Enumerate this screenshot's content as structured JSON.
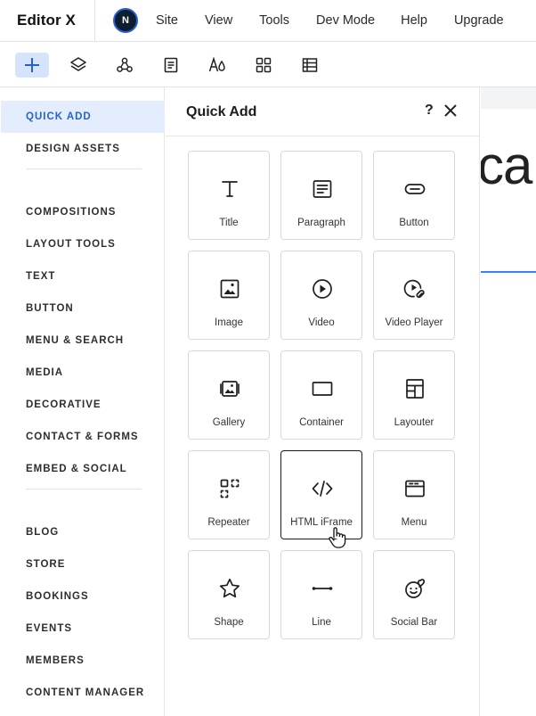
{
  "brand": "Editor X",
  "avatar_initial": "N",
  "menu": [
    "Site",
    "View",
    "Tools",
    "Dev Mode",
    "Help",
    "Upgrade"
  ],
  "toolbar": {
    "tools": [
      "add-icon",
      "layers-icon",
      "apps-icon",
      "pages-icon",
      "theme-icon",
      "grid-icon",
      "table-icon"
    ],
    "active": "add-icon",
    "accent": "#2563c9"
  },
  "sidebar": {
    "groups": [
      [
        "QUICK ADD",
        "DESIGN ASSETS"
      ],
      [
        "COMPOSITIONS",
        "LAYOUT TOOLS",
        "TEXT",
        "BUTTON",
        "MENU & SEARCH",
        "MEDIA",
        "DECORATIVE",
        "CONTACT & FORMS",
        "EMBED & SOCIAL"
      ],
      [
        "BLOG",
        "STORE",
        "BOOKINGS",
        "EVENTS",
        "MEMBERS",
        "CONTENT MANAGER"
      ]
    ],
    "active": "QUICK ADD"
  },
  "panel": {
    "title": "Quick Add",
    "help": "?",
    "items": [
      {
        "label": "Title",
        "icon": "title-icon"
      },
      {
        "label": "Paragraph",
        "icon": "paragraph-icon"
      },
      {
        "label": "Button",
        "icon": "button-icon"
      },
      {
        "label": "Image",
        "icon": "image-icon"
      },
      {
        "label": "Video",
        "icon": "video-icon"
      },
      {
        "label": "Video Player",
        "icon": "video-player-icon"
      },
      {
        "label": "Gallery",
        "icon": "gallery-icon"
      },
      {
        "label": "Container",
        "icon": "container-icon"
      },
      {
        "label": "Layouter",
        "icon": "layouter-icon"
      },
      {
        "label": "Repeater",
        "icon": "repeater-icon"
      },
      {
        "label": "HTML iFrame",
        "icon": "code-icon"
      },
      {
        "label": "Menu",
        "icon": "menu-icon"
      },
      {
        "label": "Shape",
        "icon": "star-icon"
      },
      {
        "label": "Line",
        "icon": "line-icon"
      },
      {
        "label": "Social Bar",
        "icon": "social-bar-icon"
      }
    ],
    "hovered": "HTML iFrame"
  },
  "canvas": {
    "text_fragment": "ca"
  }
}
